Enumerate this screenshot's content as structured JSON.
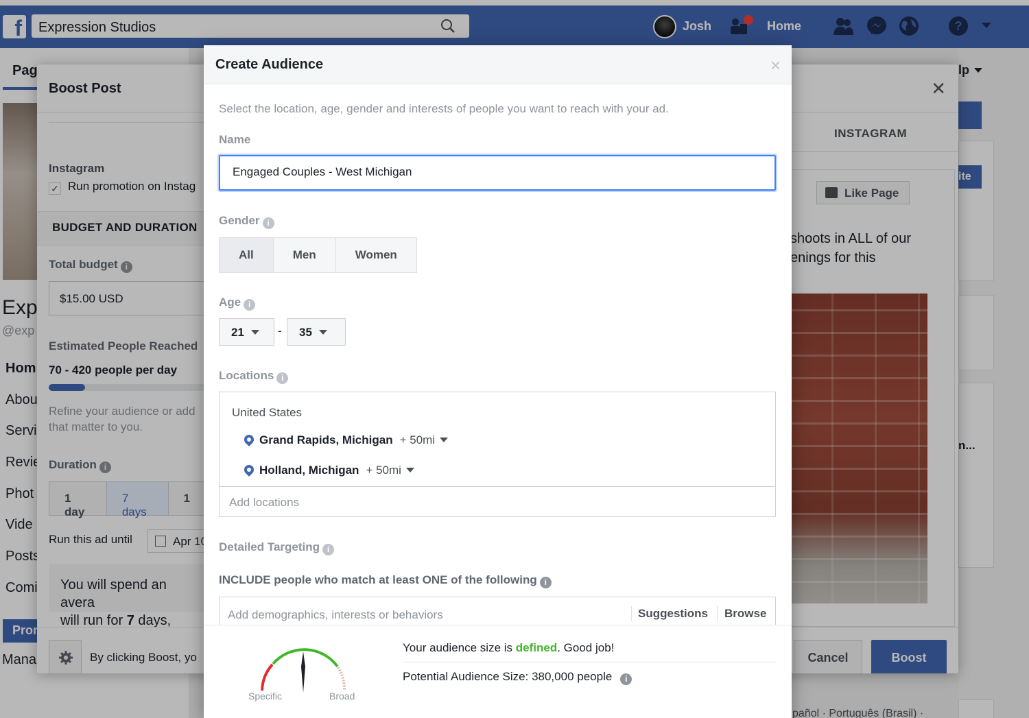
{
  "fb_header": {
    "search_text": "Expression Studios",
    "user_name": "Josh",
    "home_label": "Home"
  },
  "page": {
    "tab_label": "Pag",
    "title_fragment": "Exp",
    "handle_fragment": "@exp",
    "nav": [
      "Hom",
      "Abou",
      "Servi",
      "Revie",
      "Phot",
      "Vide",
      "Posts",
      "Comi"
    ],
    "promote_fragment": "Pron",
    "manage_fragment": "Mana",
    "help_fragment": "lp",
    "right_fragment_1": "ite",
    "right_fragment_2": "n...",
    "lang_fragment": "pañol · Português (Brasil) ·"
  },
  "boost_post": {
    "title": "Boost Post",
    "instagram_label": "Instagram",
    "run_promotion_label": "Run promotion on Instag",
    "section_budget": "BUDGET AND DURATION",
    "total_budget_label": "Total budget",
    "total_budget_value": "$15.00 USD",
    "reach_label": "Estimated People Reached",
    "reach_value": "70 - 420 people per day",
    "reach_progress": 0.23,
    "refine_text_1": "Refine your audience or add",
    "refine_text_2": "that matter to you.",
    "duration_label": "Duration",
    "durations": [
      "1 day",
      "7 days",
      "1"
    ],
    "duration_selected": "7 days",
    "run_until_label": "Run this ad until",
    "run_until_value": "Apr 10",
    "spend_text_1": "You will spend an avera",
    "spend_text_2a": "will run for ",
    "spend_days": "7",
    "spend_text_2b": " days, end",
    "footer_text": "By clicking Boost, yo",
    "cancel_label": "Cancel",
    "boost_label": "Boost",
    "instagram_tab": "INSTAGRAM",
    "like_page_label": "Like Page",
    "preview_text_1": "shoots in ALL of our",
    "preview_text_2": "enings for this"
  },
  "create_audience": {
    "title": "Create Audience",
    "close_symbol": "×",
    "intro": "Select the location, age, gender and interests of people you want to reach with your ad.",
    "name_label": "Name",
    "name_value": "Engaged Couples - West Michigan",
    "gender_label": "Gender",
    "gender_options": [
      "All",
      "Men",
      "Women"
    ],
    "gender_selected": "All",
    "age_label": "Age",
    "age_min": "21",
    "age_max": "35",
    "age_separator": "-",
    "locations_label": "Locations",
    "location_country": "United States",
    "locations": [
      {
        "name": "Grand Rapids, Michigan",
        "radius": "+ 50mi"
      },
      {
        "name": "Holland, Michigan",
        "radius": "+ 50mi"
      }
    ],
    "add_locations_placeholder": "Add locations",
    "detailed_targeting_label": "Detailed Targeting",
    "include_text": "INCLUDE people who match at least ONE of the following",
    "targeting_placeholder": "Add demographics, interests or behaviors",
    "suggestions_label": "Suggestions",
    "browse_label": "Browse",
    "audience_size_prefix": "Your audience size is ",
    "audience_size_status": "defined",
    "audience_size_suffix": ". Good job!",
    "potential_size": "Potential Audience Size: 380,000 people",
    "gauge_specific": "Specific",
    "gauge_broad": "Broad"
  },
  "colors": {
    "facebook_blue": "#4267b2",
    "focus_blue": "#4080ff",
    "defined_green": "#42b72a",
    "gauge_red": "#e02d2d"
  }
}
